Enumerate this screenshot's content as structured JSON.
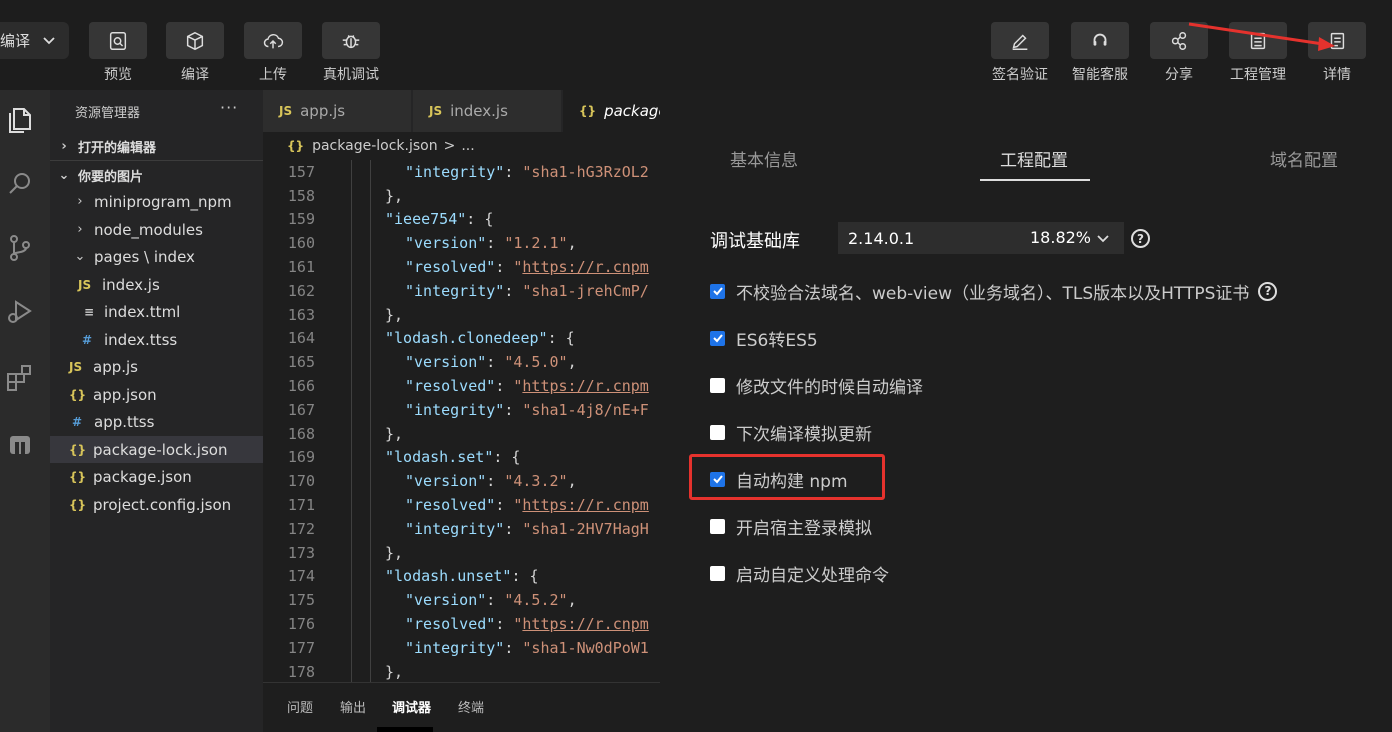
{
  "toolbar": {
    "compile_select": "编译",
    "left_tools": [
      {
        "label": "预览",
        "icon": "preview-icon"
      },
      {
        "label": "编译",
        "icon": "cube-icon"
      },
      {
        "label": "上传",
        "icon": "upload-cloud-icon"
      },
      {
        "label": "真机调试",
        "icon": "bug-icon"
      }
    ],
    "right_tools": [
      {
        "label": "签名验证",
        "icon": "pen-icon"
      },
      {
        "label": "智能客服",
        "icon": "headset-icon"
      },
      {
        "label": "分享",
        "icon": "share-icon"
      },
      {
        "label": "工程管理",
        "icon": "list-icon"
      },
      {
        "label": "详情",
        "icon": "details-icon"
      }
    ]
  },
  "explorer": {
    "title": "资源管理器",
    "more": "···",
    "open_editors": "打开的编辑器",
    "project_root": "你要的图片",
    "items": [
      {
        "label": "miniprogram_npm",
        "icon": ""
      },
      {
        "label": "node_modules",
        "icon": ""
      },
      {
        "label": "pages \\ index",
        "icon": ""
      },
      {
        "label": "index.js",
        "icon": "JS"
      },
      {
        "label": "index.ttml",
        "icon": "≡"
      },
      {
        "label": "index.ttss",
        "icon": "#"
      },
      {
        "label": "app.js",
        "icon": "JS"
      },
      {
        "label": "app.json",
        "icon": "{}"
      },
      {
        "label": "app.ttss",
        "icon": "#"
      },
      {
        "label": "package-lock.json",
        "icon": "{}"
      },
      {
        "label": "package.json",
        "icon": "{}"
      },
      {
        "label": "project.config.json",
        "icon": "{}"
      }
    ]
  },
  "editor": {
    "tabs": [
      {
        "label": "app.js",
        "icon": "JS"
      },
      {
        "label": "index.js",
        "icon": "JS"
      },
      {
        "label": "package",
        "icon": "{}"
      }
    ],
    "breadcrumb": {
      "file": "package-lock.json",
      "sep": ">",
      "rest": "..."
    },
    "lines": [
      {
        "n": "157",
        "tokens": [
          [
            "k",
            "\"integrity\""
          ],
          [
            "p",
            ": "
          ],
          [
            "s",
            "\"sha1-hG3RzOL2"
          ]
        ]
      },
      {
        "n": "158",
        "tokens": [
          [
            "p",
            "},"
          ]
        ]
      },
      {
        "n": "159",
        "tokens": [
          [
            "k",
            "\"ieee754\""
          ],
          [
            "p",
            ": {"
          ]
        ]
      },
      {
        "n": "160",
        "tokens": [
          [
            "k",
            "\"version\""
          ],
          [
            "p",
            ": "
          ],
          [
            "s",
            "\"1.2.1\""
          ],
          [
            "p",
            ","
          ]
        ]
      },
      {
        "n": "161",
        "tokens": [
          [
            "k",
            "\"resolved\""
          ],
          [
            "p",
            ": "
          ],
          [
            "s",
            "\""
          ],
          [
            "u",
            "https://r.cnpm"
          ]
        ]
      },
      {
        "n": "162",
        "tokens": [
          [
            "k",
            "\"integrity\""
          ],
          [
            "p",
            ": "
          ],
          [
            "s",
            "\"sha1-jrehCmP/"
          ]
        ]
      },
      {
        "n": "163",
        "tokens": [
          [
            "p",
            "},"
          ]
        ]
      },
      {
        "n": "164",
        "tokens": [
          [
            "k",
            "\"lodash.clonedeep\""
          ],
          [
            "p",
            ": {"
          ]
        ]
      },
      {
        "n": "165",
        "tokens": [
          [
            "k",
            "\"version\""
          ],
          [
            "p",
            ": "
          ],
          [
            "s",
            "\"4.5.0\""
          ],
          [
            "p",
            ","
          ]
        ]
      },
      {
        "n": "166",
        "tokens": [
          [
            "k",
            "\"resolved\""
          ],
          [
            "p",
            ": "
          ],
          [
            "s",
            "\""
          ],
          [
            "u",
            "https://r.cnpm"
          ]
        ]
      },
      {
        "n": "167",
        "tokens": [
          [
            "k",
            "\"integrity\""
          ],
          [
            "p",
            ": "
          ],
          [
            "s",
            "\"sha1-4j8/nE+F"
          ]
        ]
      },
      {
        "n": "168",
        "tokens": [
          [
            "p",
            "},"
          ]
        ]
      },
      {
        "n": "169",
        "tokens": [
          [
            "k",
            "\"lodash.set\""
          ],
          [
            "p",
            ": {"
          ]
        ]
      },
      {
        "n": "170",
        "tokens": [
          [
            "k",
            "\"version\""
          ],
          [
            "p",
            ": "
          ],
          [
            "s",
            "\"4.3.2\""
          ],
          [
            "p",
            ","
          ]
        ]
      },
      {
        "n": "171",
        "tokens": [
          [
            "k",
            "\"resolved\""
          ],
          [
            "p",
            ": "
          ],
          [
            "s",
            "\""
          ],
          [
            "u",
            "https://r.cnpm"
          ]
        ]
      },
      {
        "n": "172",
        "tokens": [
          [
            "k",
            "\"integrity\""
          ],
          [
            "p",
            ": "
          ],
          [
            "s",
            "\"sha1-2HV7HagH"
          ]
        ]
      },
      {
        "n": "173",
        "tokens": [
          [
            "p",
            "},"
          ]
        ]
      },
      {
        "n": "174",
        "tokens": [
          [
            "k",
            "\"lodash.unset\""
          ],
          [
            "p",
            ": {"
          ]
        ]
      },
      {
        "n": "175",
        "tokens": [
          [
            "k",
            "\"version\""
          ],
          [
            "p",
            ": "
          ],
          [
            "s",
            "\"4.5.2\""
          ],
          [
            "p",
            ","
          ]
        ]
      },
      {
        "n": "176",
        "tokens": [
          [
            "k",
            "\"resolved\""
          ],
          [
            "p",
            ": "
          ],
          [
            "s",
            "\""
          ],
          [
            "u",
            "https://r.cnpm"
          ]
        ]
      },
      {
        "n": "177",
        "tokens": [
          [
            "k",
            "\"integrity\""
          ],
          [
            "p",
            ": "
          ],
          [
            "s",
            "\"sha1-Nw0dPoW1"
          ]
        ]
      },
      {
        "n": "178",
        "tokens": [
          [
            "p",
            "},"
          ]
        ]
      }
    ],
    "panel_tabs": [
      "问题",
      "输出",
      "调试器",
      "终端"
    ]
  },
  "details": {
    "tabs": [
      "基本信息",
      "工程配置",
      "域名配置"
    ],
    "active_tab": "工程配置",
    "base_lib_label": "调试基础库",
    "base_lib_version": "2.14.0.1",
    "base_lib_percent": "18.82%",
    "options": [
      {
        "label": "不校验合法域名、web-view（业务域名）、TLS版本以及HTTPS证书",
        "checked": true,
        "help": "?"
      },
      {
        "label": "ES6转ES5",
        "checked": true
      },
      {
        "label": "修改文件的时候自动编译",
        "checked": false
      },
      {
        "label": "下次编译模拟更新",
        "checked": false
      },
      {
        "label": "自动构建 npm",
        "checked": true
      },
      {
        "label": "开启宿主登录模拟",
        "checked": false
      },
      {
        "label": "启动自定义处理命令",
        "checked": false
      }
    ]
  },
  "colors": {
    "accent": "#1e73e8",
    "annotation": "#e5322d"
  }
}
